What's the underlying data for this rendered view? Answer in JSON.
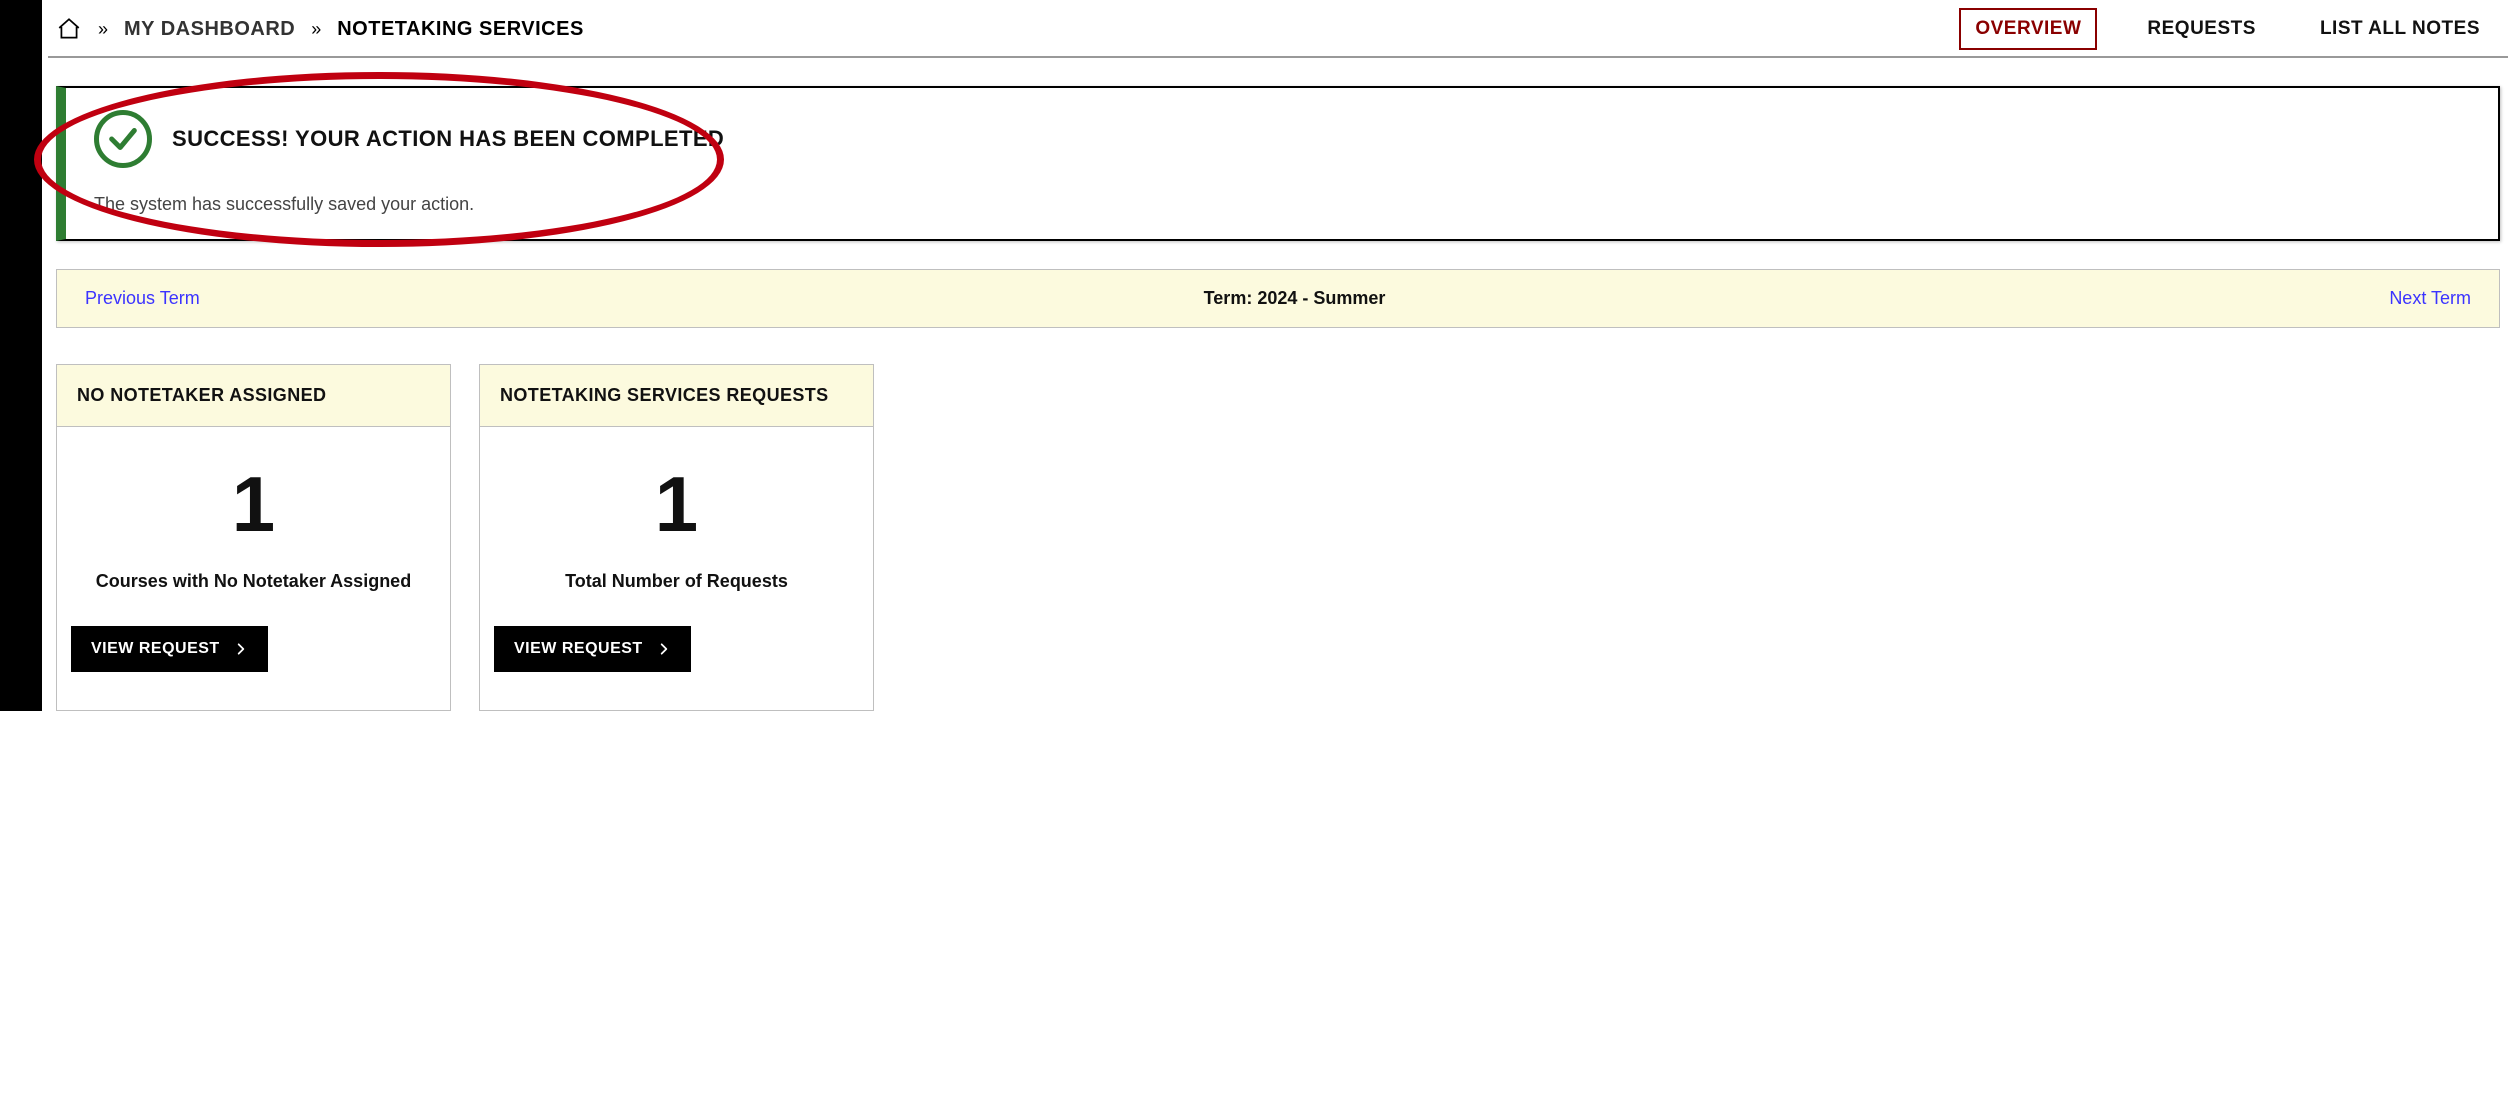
{
  "breadcrumb": {
    "dashboard_label": "MY DASHBOARD",
    "current_label": "NOTETAKING SERVICES"
  },
  "tabs": {
    "overview": "OVERVIEW",
    "requests": "REQUESTS",
    "list_all_notes": "LIST ALL NOTES"
  },
  "banner": {
    "title": "SUCCESS! YOUR ACTION HAS BEEN COMPLETED",
    "subtitle": "The system has successfully saved your action."
  },
  "term_bar": {
    "prev": "Previous Term",
    "label": "Term: 2024 - Summer",
    "next": "Next Term"
  },
  "cards": [
    {
      "title": "NO NOTETAKER ASSIGNED",
      "value": "1",
      "subtitle": "Courses with No Notetaker Assigned",
      "button": "VIEW REQUEST"
    },
    {
      "title": "NOTETAKING SERVICES REQUESTS",
      "value": "1",
      "subtitle": "Total Number of Requests",
      "button": "VIEW REQUEST"
    }
  ]
}
